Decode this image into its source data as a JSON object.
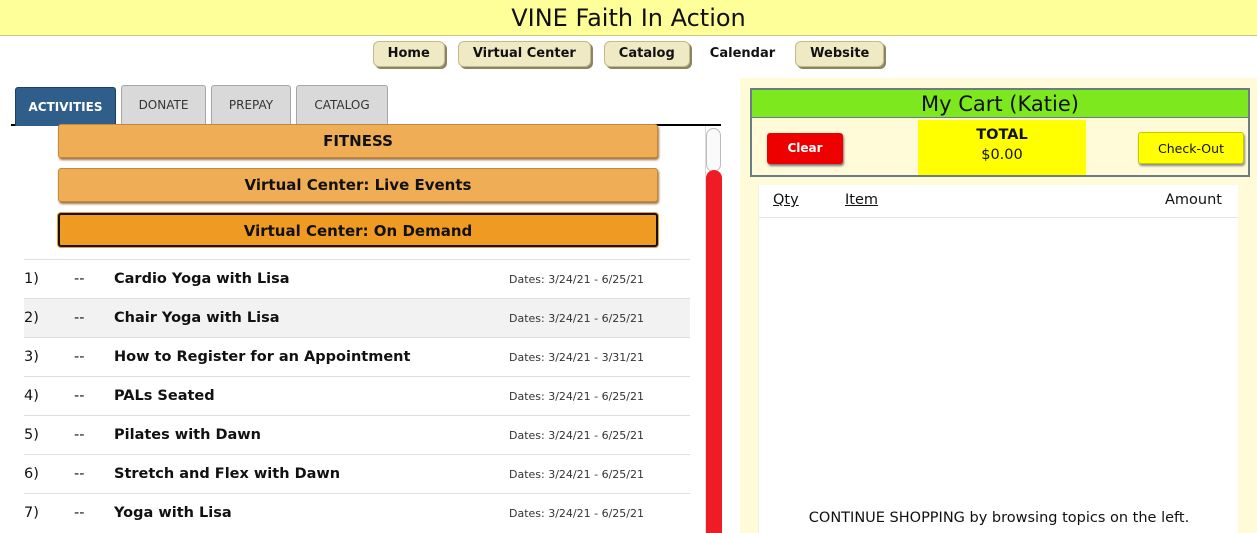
{
  "header": {
    "title": "VINE Faith In Action"
  },
  "nav": {
    "home": "Home",
    "virtual_center": "Virtual Center",
    "catalog": "Catalog",
    "calendar": "Calendar",
    "website": "Website"
  },
  "tabs": {
    "activities": "ACTIVITIES",
    "donate": "DONATE",
    "prepay": "PREPAY",
    "catalog": "CATALOG"
  },
  "categories": {
    "fitness": "FITNESS",
    "live": "Virtual Center: Live Events",
    "on_demand": "Virtual Center: On Demand"
  },
  "activities": [
    {
      "num": "1)",
      "dash": "--",
      "title": "Cardio Yoga with Lisa",
      "dates": "Dates: 3/24/21 - 6/25/21"
    },
    {
      "num": "2)",
      "dash": "--",
      "title": "Chair Yoga with Lisa",
      "dates": "Dates: 3/24/21 - 6/25/21"
    },
    {
      "num": "3)",
      "dash": "--",
      "title": "How to Register for an Appointment",
      "dates": "Dates: 3/24/21 - 3/31/21"
    },
    {
      "num": "4)",
      "dash": "--",
      "title": "PALs Seated",
      "dates": "Dates: 3/24/21 - 6/25/21"
    },
    {
      "num": "5)",
      "dash": "--",
      "title": "Pilates with Dawn",
      "dates": "Dates: 3/24/21 - 6/25/21"
    },
    {
      "num": "6)",
      "dash": "--",
      "title": "Stretch and Flex with Dawn",
      "dates": "Dates: 3/24/21 - 6/25/21"
    },
    {
      "num": "7)",
      "dash": "--",
      "title": "Yoga with Lisa",
      "dates": "Dates: 3/24/21 - 6/25/21"
    }
  ],
  "cart": {
    "title": "My Cart (Katie)",
    "clear_label": "Clear",
    "total_label": "TOTAL",
    "total_amount": "$0.00",
    "checkout_label": "Check-Out",
    "col_qty": "Qty",
    "col_item": "Item",
    "col_amount": "Amount",
    "continue_text": "CONTINUE SHOPPING by browsing topics on the left."
  },
  "colors": {
    "title_bar": "#ffff99",
    "cart_header": "#7ee81f",
    "category_button": "#efad55",
    "active_tab": "#2f5e8b",
    "clear_button": "#ee0000",
    "checkout_button": "#ffff00",
    "scrollbar": "#ee1c24"
  }
}
